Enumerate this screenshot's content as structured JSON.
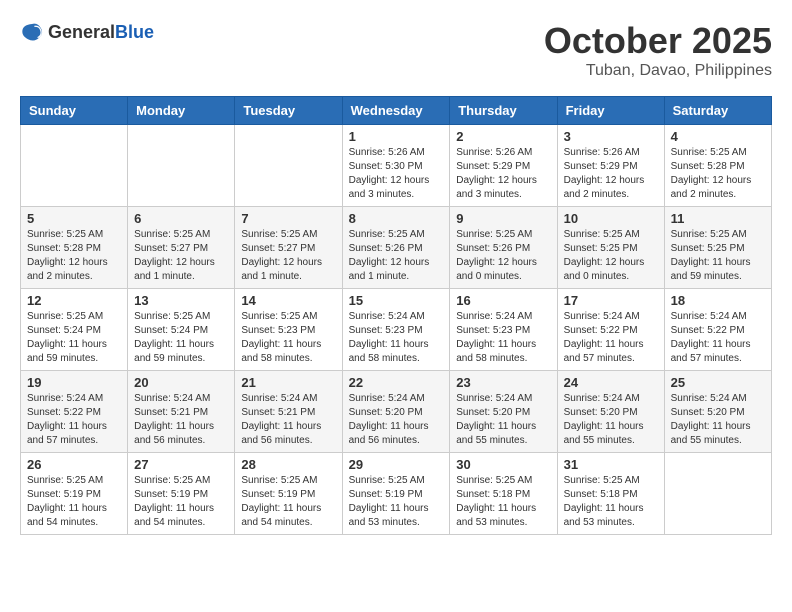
{
  "header": {
    "logo_general": "General",
    "logo_blue": "Blue",
    "month": "October 2025",
    "location": "Tuban, Davao, Philippines"
  },
  "weekdays": [
    "Sunday",
    "Monday",
    "Tuesday",
    "Wednesday",
    "Thursday",
    "Friday",
    "Saturday"
  ],
  "weeks": [
    [
      {
        "day": "",
        "info": ""
      },
      {
        "day": "",
        "info": ""
      },
      {
        "day": "",
        "info": ""
      },
      {
        "day": "1",
        "info": "Sunrise: 5:26 AM\nSunset: 5:30 PM\nDaylight: 12 hours and 3 minutes."
      },
      {
        "day": "2",
        "info": "Sunrise: 5:26 AM\nSunset: 5:29 PM\nDaylight: 12 hours and 3 minutes."
      },
      {
        "day": "3",
        "info": "Sunrise: 5:26 AM\nSunset: 5:29 PM\nDaylight: 12 hours and 2 minutes."
      },
      {
        "day": "4",
        "info": "Sunrise: 5:25 AM\nSunset: 5:28 PM\nDaylight: 12 hours and 2 minutes."
      }
    ],
    [
      {
        "day": "5",
        "info": "Sunrise: 5:25 AM\nSunset: 5:28 PM\nDaylight: 12 hours and 2 minutes."
      },
      {
        "day": "6",
        "info": "Sunrise: 5:25 AM\nSunset: 5:27 PM\nDaylight: 12 hours and 1 minute."
      },
      {
        "day": "7",
        "info": "Sunrise: 5:25 AM\nSunset: 5:27 PM\nDaylight: 12 hours and 1 minute."
      },
      {
        "day": "8",
        "info": "Sunrise: 5:25 AM\nSunset: 5:26 PM\nDaylight: 12 hours and 1 minute."
      },
      {
        "day": "9",
        "info": "Sunrise: 5:25 AM\nSunset: 5:26 PM\nDaylight: 12 hours and 0 minutes."
      },
      {
        "day": "10",
        "info": "Sunrise: 5:25 AM\nSunset: 5:25 PM\nDaylight: 12 hours and 0 minutes."
      },
      {
        "day": "11",
        "info": "Sunrise: 5:25 AM\nSunset: 5:25 PM\nDaylight: 11 hours and 59 minutes."
      }
    ],
    [
      {
        "day": "12",
        "info": "Sunrise: 5:25 AM\nSunset: 5:24 PM\nDaylight: 11 hours and 59 minutes."
      },
      {
        "day": "13",
        "info": "Sunrise: 5:25 AM\nSunset: 5:24 PM\nDaylight: 11 hours and 59 minutes."
      },
      {
        "day": "14",
        "info": "Sunrise: 5:25 AM\nSunset: 5:23 PM\nDaylight: 11 hours and 58 minutes."
      },
      {
        "day": "15",
        "info": "Sunrise: 5:24 AM\nSunset: 5:23 PM\nDaylight: 11 hours and 58 minutes."
      },
      {
        "day": "16",
        "info": "Sunrise: 5:24 AM\nSunset: 5:23 PM\nDaylight: 11 hours and 58 minutes."
      },
      {
        "day": "17",
        "info": "Sunrise: 5:24 AM\nSunset: 5:22 PM\nDaylight: 11 hours and 57 minutes."
      },
      {
        "day": "18",
        "info": "Sunrise: 5:24 AM\nSunset: 5:22 PM\nDaylight: 11 hours and 57 minutes."
      }
    ],
    [
      {
        "day": "19",
        "info": "Sunrise: 5:24 AM\nSunset: 5:22 PM\nDaylight: 11 hours and 57 minutes."
      },
      {
        "day": "20",
        "info": "Sunrise: 5:24 AM\nSunset: 5:21 PM\nDaylight: 11 hours and 56 minutes."
      },
      {
        "day": "21",
        "info": "Sunrise: 5:24 AM\nSunset: 5:21 PM\nDaylight: 11 hours and 56 minutes."
      },
      {
        "day": "22",
        "info": "Sunrise: 5:24 AM\nSunset: 5:20 PM\nDaylight: 11 hours and 56 minutes."
      },
      {
        "day": "23",
        "info": "Sunrise: 5:24 AM\nSunset: 5:20 PM\nDaylight: 11 hours and 55 minutes."
      },
      {
        "day": "24",
        "info": "Sunrise: 5:24 AM\nSunset: 5:20 PM\nDaylight: 11 hours and 55 minutes."
      },
      {
        "day": "25",
        "info": "Sunrise: 5:24 AM\nSunset: 5:20 PM\nDaylight: 11 hours and 55 minutes."
      }
    ],
    [
      {
        "day": "26",
        "info": "Sunrise: 5:25 AM\nSunset: 5:19 PM\nDaylight: 11 hours and 54 minutes."
      },
      {
        "day": "27",
        "info": "Sunrise: 5:25 AM\nSunset: 5:19 PM\nDaylight: 11 hours and 54 minutes."
      },
      {
        "day": "28",
        "info": "Sunrise: 5:25 AM\nSunset: 5:19 PM\nDaylight: 11 hours and 54 minutes."
      },
      {
        "day": "29",
        "info": "Sunrise: 5:25 AM\nSunset: 5:19 PM\nDaylight: 11 hours and 53 minutes."
      },
      {
        "day": "30",
        "info": "Sunrise: 5:25 AM\nSunset: 5:18 PM\nDaylight: 11 hours and 53 minutes."
      },
      {
        "day": "31",
        "info": "Sunrise: 5:25 AM\nSunset: 5:18 PM\nDaylight: 11 hours and 53 minutes."
      },
      {
        "day": "",
        "info": ""
      }
    ]
  ]
}
